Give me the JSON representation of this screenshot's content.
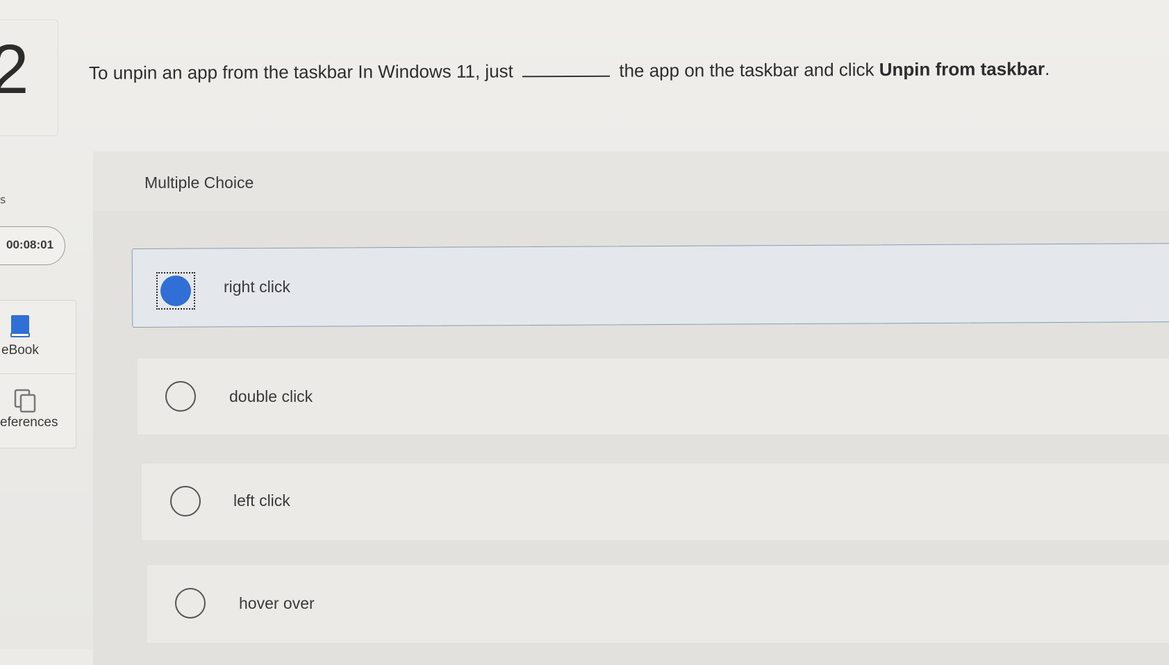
{
  "question": {
    "number": "2",
    "text_before": "To unpin an app from the taskbar In Windows 11, just",
    "text_after": "the app on the taskbar and click",
    "text_bold": "Unpin from taskbar",
    "text_end": "."
  },
  "sidebar": {
    "fragment": "s",
    "timer": "00:08:01",
    "tools": [
      {
        "label": "eBook",
        "icon": "book-icon"
      },
      {
        "label": "eferences",
        "icon": "copy-icon"
      }
    ]
  },
  "answer_section": {
    "header": "Multiple Choice",
    "choices": [
      {
        "label": "right click",
        "selected": true
      },
      {
        "label": "double click",
        "selected": false
      },
      {
        "label": "left click",
        "selected": false
      },
      {
        "label": "hover over",
        "selected": false
      }
    ]
  },
  "colors": {
    "accent": "#2f6fd6",
    "selected_bg": "#e4e8ec",
    "selected_border": "#8a9bb0"
  }
}
